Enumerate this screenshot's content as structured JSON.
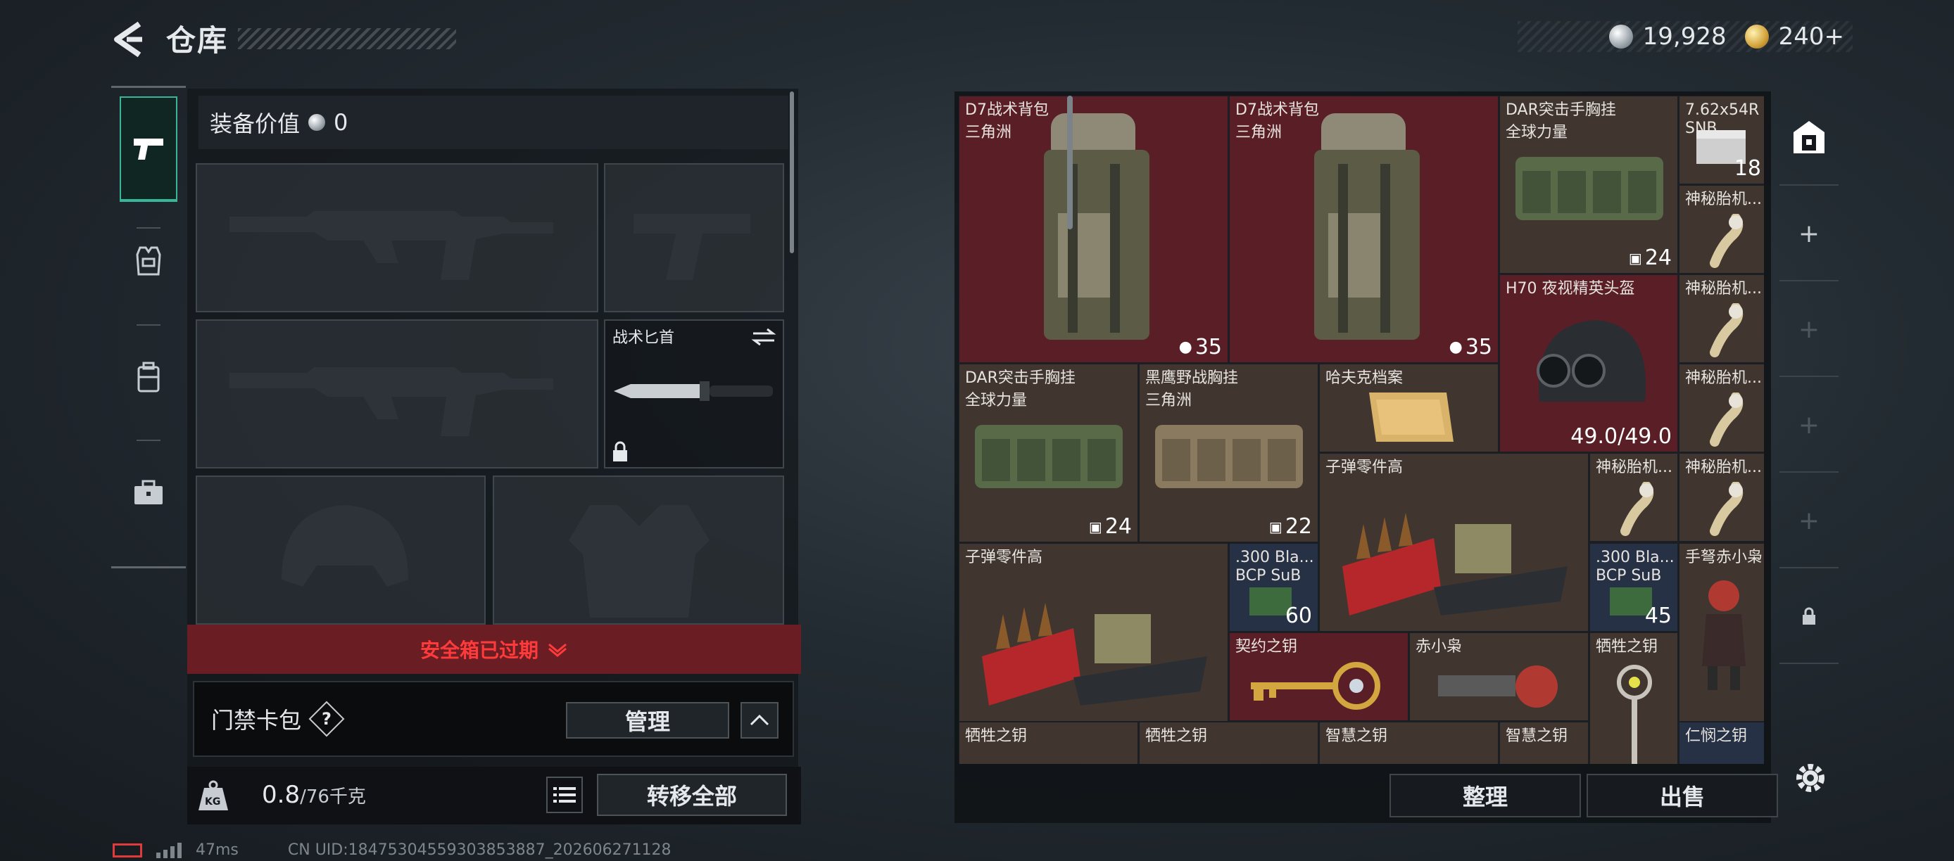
{
  "header": {
    "title": "仓库",
    "currencies": [
      {
        "icon": "silver-coin-icon",
        "value": "19,928"
      },
      {
        "icon": "gold-coin-icon",
        "value": "240+"
      }
    ]
  },
  "sidebar": {
    "tabs": [
      {
        "icon": "pistol-icon",
        "active": true
      },
      {
        "icon": "armor-vest-icon",
        "active": false
      },
      {
        "icon": "backpack-icon",
        "active": false
      },
      {
        "icon": "toolbox-icon",
        "active": false
      }
    ]
  },
  "left_panel": {
    "equip_value_label": "装备价值",
    "equip_value": "0",
    "melee_label": "战术匕首",
    "safe_box_text": "安全箱已过期",
    "access_card_label": "门禁卡包",
    "access_help": "?",
    "manage_label": "管理",
    "weight_current": "0.8",
    "weight_max": "/76千克",
    "weight_icon_text": "KG",
    "transfer_label": "转移全部"
  },
  "inventory": {
    "items": [
      {
        "name": "D7战术背包",
        "sub": "三角洲",
        "count": "35",
        "count_icon": "bag-icon"
      },
      {
        "name": "D7战术背包",
        "sub": "三角洲",
        "count": "35",
        "count_icon": "bag-icon"
      },
      {
        "name": "DAR突击手胸挂",
        "sub": "全球力量",
        "count": "24",
        "count_icon": "vest-icon"
      },
      {
        "name": "7.62x54R",
        "sub": "SNB",
        "count": "18"
      },
      {
        "name": "神秘胎机...",
        "sub": ""
      },
      {
        "name": "H70 夜视精英头盔",
        "sub": "",
        "count": "49.0/49.0"
      },
      {
        "name": "神秘胎机...",
        "sub": ""
      },
      {
        "name": "DAR突击手胸挂",
        "sub": "全球力量",
        "count": "24",
        "count_icon": "vest-icon"
      },
      {
        "name": "黑鹰野战胸挂",
        "sub": "三角洲",
        "count": "22",
        "count_icon": "vest-icon"
      },
      {
        "name": "哈夫克档案",
        "sub": ""
      },
      {
        "name": "神秘胎机...",
        "sub": ""
      },
      {
        "name": "子弹零件高",
        "sub": ""
      },
      {
        "name": "神秘胎机...",
        "sub": ""
      },
      {
        "name": "神秘胎机...",
        "sub": ""
      },
      {
        "name": "子弹零件高",
        "sub": ""
      },
      {
        "name": ".300 Bla...",
        "sub": "BCP SuB",
        "count": "60"
      },
      {
        "name": ".300 Bla...",
        "sub": "BCP SuB",
        "count": "45"
      },
      {
        "name": "手弩赤小枭",
        "sub": ""
      },
      {
        "name": "契约之钥",
        "sub": ""
      },
      {
        "name": "赤小枭",
        "sub": ""
      },
      {
        "name": "牺牲之钥",
        "sub": ""
      },
      {
        "name": "牺牲之钥",
        "sub": ""
      },
      {
        "name": "牺牲之钥",
        "sub": ""
      },
      {
        "name": "智慧之钥",
        "sub": ""
      },
      {
        "name": "智慧之钥",
        "sub": ""
      },
      {
        "name": "仁悯之钥",
        "sub": ""
      }
    ],
    "sort_label": "整理",
    "sell_label": "出售"
  },
  "footer": {
    "ping": "47ms",
    "uid": "CN UID:18475304559303853887_202606271128"
  },
  "colors": {
    "accent_teal": "#39b59a",
    "warning_red": "#ff3a3a",
    "cell_brown": "#40352f",
    "cell_red": "#5a1f26",
    "cell_blue": "#263145"
  }
}
